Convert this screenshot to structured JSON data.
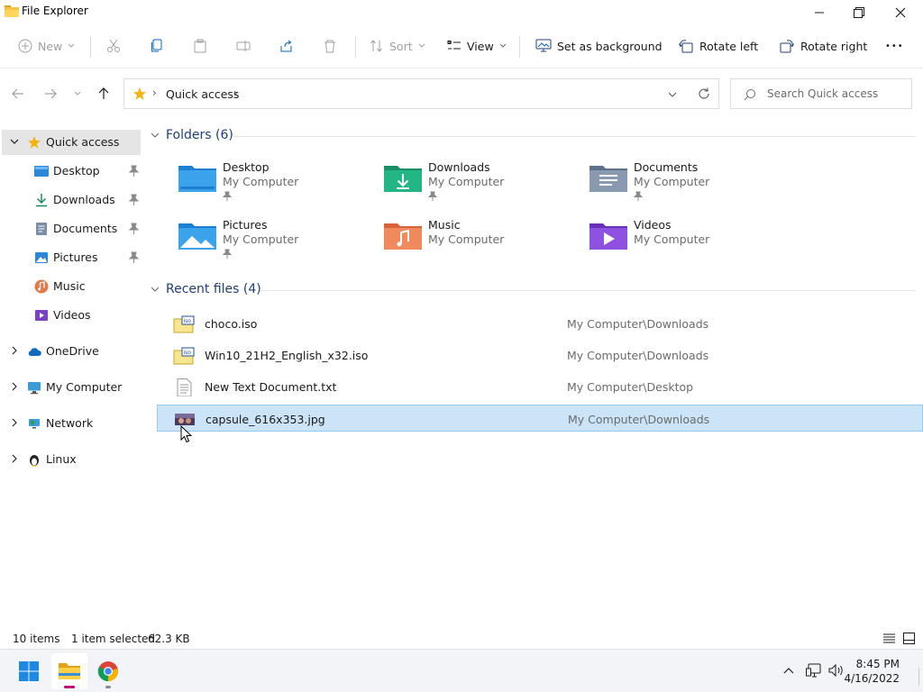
{
  "window": {
    "title": "File Explorer",
    "minimize_glyph": "—",
    "maximize_glyph": "❐",
    "close_glyph": "✕"
  },
  "toolbar": {
    "new_label": "New",
    "sort_label": "Sort",
    "view_label": "View",
    "set_background_label": "Set as background",
    "rotate_left_label": "Rotate left",
    "rotate_right_label": "Rotate right",
    "more_glyph": "•••"
  },
  "address": {
    "path_label": "Quick access",
    "separator": "›"
  },
  "search": {
    "placeholder": "Search Quick access"
  },
  "sidebar": {
    "items": [
      {
        "label": "Quick access",
        "icon": "star-icon"
      },
      {
        "label": "Desktop",
        "icon": "desktop-icon",
        "pinned": true
      },
      {
        "label": "Downloads",
        "icon": "download-icon",
        "pinned": true
      },
      {
        "label": "Documents",
        "icon": "documents-icon",
        "pinned": true
      },
      {
        "label": "Pictures",
        "icon": "pictures-icon",
        "pinned": true
      },
      {
        "label": "Music",
        "icon": "music-icon"
      },
      {
        "label": "Videos",
        "icon": "videos-icon"
      },
      {
        "label": "OneDrive",
        "icon": "cloud-icon"
      },
      {
        "label": "My Computer",
        "icon": "monitor-icon"
      },
      {
        "label": "Network",
        "icon": "network-icon"
      },
      {
        "label": "Linux",
        "icon": "penguin-icon"
      }
    ]
  },
  "folders": {
    "header": "Folders (6)",
    "items": [
      {
        "name": "Desktop",
        "location": "My Computer",
        "pinned": true
      },
      {
        "name": "Downloads",
        "location": "My Computer",
        "pinned": true
      },
      {
        "name": "Documents",
        "location": "My Computer",
        "pinned": true
      },
      {
        "name": "Pictures",
        "location": "My Computer",
        "pinned": true
      },
      {
        "name": "Music",
        "location": "My Computer"
      },
      {
        "name": "Videos",
        "location": "My Computer"
      }
    ]
  },
  "recent": {
    "header": "Recent files (4)",
    "items": [
      {
        "name": "choco.iso",
        "location": "My Computer\\Downloads",
        "icon": "iso-icon"
      },
      {
        "name": "Win10_21H2_English_x32.iso",
        "location": "My Computer\\Downloads",
        "icon": "iso-icon"
      },
      {
        "name": "New Text Document.txt",
        "location": "My Computer\\Desktop",
        "icon": "text-file-icon"
      },
      {
        "name": "capsule_616x353.jpg",
        "location": "My Computer\\Downloads",
        "icon": "image-file-icon",
        "selected": true
      }
    ]
  },
  "status": {
    "item_count": "10 items",
    "selection": "1 item selected",
    "size": "62.3 KB"
  },
  "taskbar": {
    "time": "8:45 PM",
    "date": "4/16/2022"
  },
  "colors": {
    "accent": "#0067c0",
    "selection_bg": "#cce4f7",
    "group_header": "#1f3f78"
  }
}
